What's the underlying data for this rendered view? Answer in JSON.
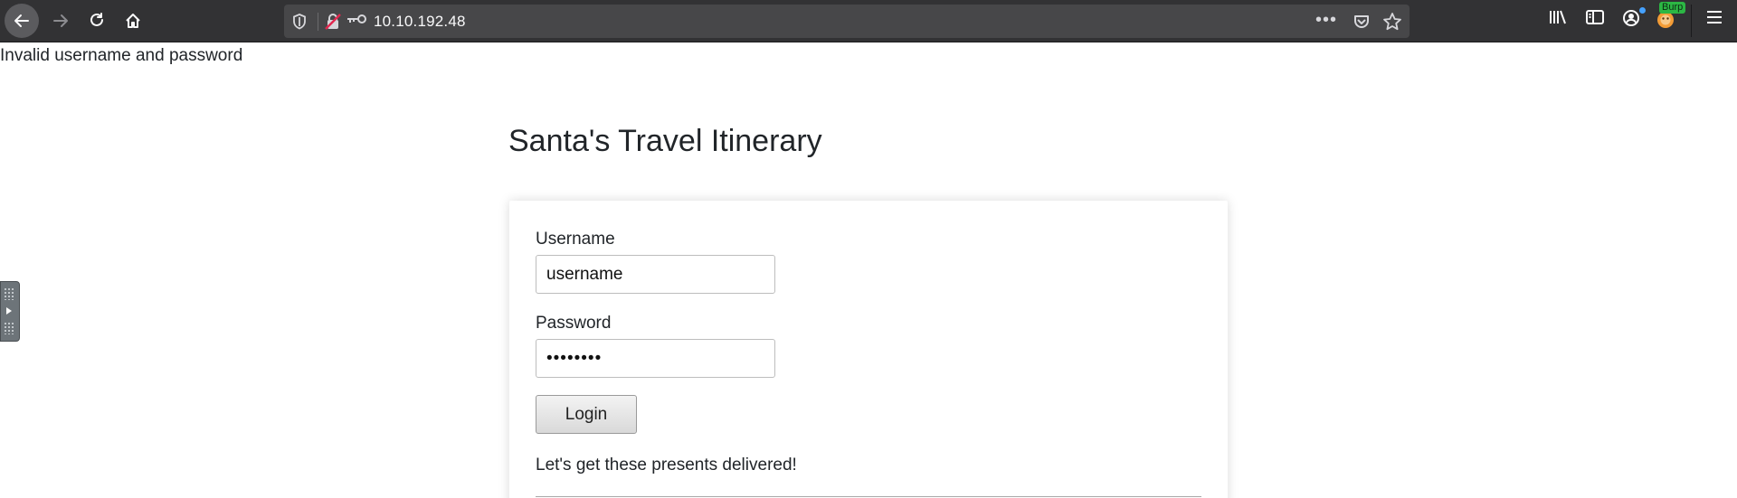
{
  "browser": {
    "url": "10.10.192.48",
    "burp_badge": "Burp",
    "url_dots": "•••",
    "icons": [
      "back-icon",
      "forward-icon",
      "reload-icon",
      "home-icon",
      "shield-icon",
      "insecure-lock-icon",
      "key-icon",
      "page-actions-icon",
      "pocket-icon",
      "bookmark-star-icon",
      "library-icon",
      "sidebar-icon",
      "account-icon",
      "burp-extension-icon",
      "menu-icon"
    ]
  },
  "page": {
    "error": "Invalid username and password",
    "title": "Santa's Travel Itinerary",
    "form": {
      "username_label": "Username",
      "username_value": "username",
      "password_label": "Password",
      "password_value": "********",
      "login_label": "Login"
    },
    "tagline": "Let's get these presents delivered!"
  }
}
